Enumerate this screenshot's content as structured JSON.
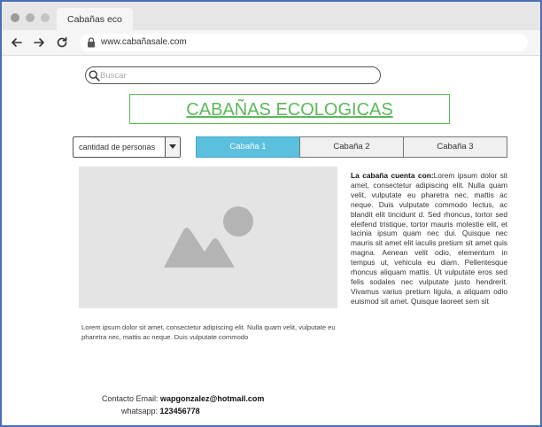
{
  "browser": {
    "tab_title": "Cabañas eco",
    "url": "www.cabañasale.com"
  },
  "search": {
    "placeholder": "Buscar"
  },
  "page_title": "CABAÑAS ECOLOGICAS",
  "people_select": {
    "label": "cantidad de personas"
  },
  "cabin_tabs": [
    {
      "label": "Cabaña 1",
      "active": true
    },
    {
      "label": "Cabaña 2",
      "active": false
    },
    {
      "label": "Cabaña 3",
      "active": false
    }
  ],
  "image": {
    "icon": "image-placeholder-icon"
  },
  "caption": "Lorem ipsum dolor sit amet, consectetur adipiscing elit. Nulla quam velit, vulputate eu pharetra nec, mattis ac neque. Duis vulputate commodo",
  "description": {
    "heading": "La cabaña cuenta con:",
    "body": "Lorem ipsum dolor sit amet, consectetur adipiscing elit. Nulla quam velit, vulputate eu pharetra nec, mattis ac neque. Duis vulputate commodo lectus, ac blandit elit tincidunt d. Sed rhoncus, tortor sed eleifend tristique, tortor mauris molestie elit, et lacinia ipsum quam nec dui. Quisque nec mauris sit amet elit iaculis pretium sit amet quis magna. Aenean velit odio, elementum in tempus ut, vehicula eu diam. Pellentesque rhoncus aliquam mattis. Ut vulputate eros sed felis sodales nec vulputate justo hendrerit. Vivamus varius pretium ligula, a aliquam odio euismod sit amet. Quisque laoreet sem sit"
  },
  "contact": {
    "email_label": "Contacto Email:",
    "email": "wapgonzalez@hotmail.com",
    "whatsapp_label": "whatsapp:",
    "whatsapp": "123456778"
  },
  "colors": {
    "title_green": "#5cb85c",
    "active_tab": "#5bc0de",
    "frame_border": "#4a6fb8"
  }
}
